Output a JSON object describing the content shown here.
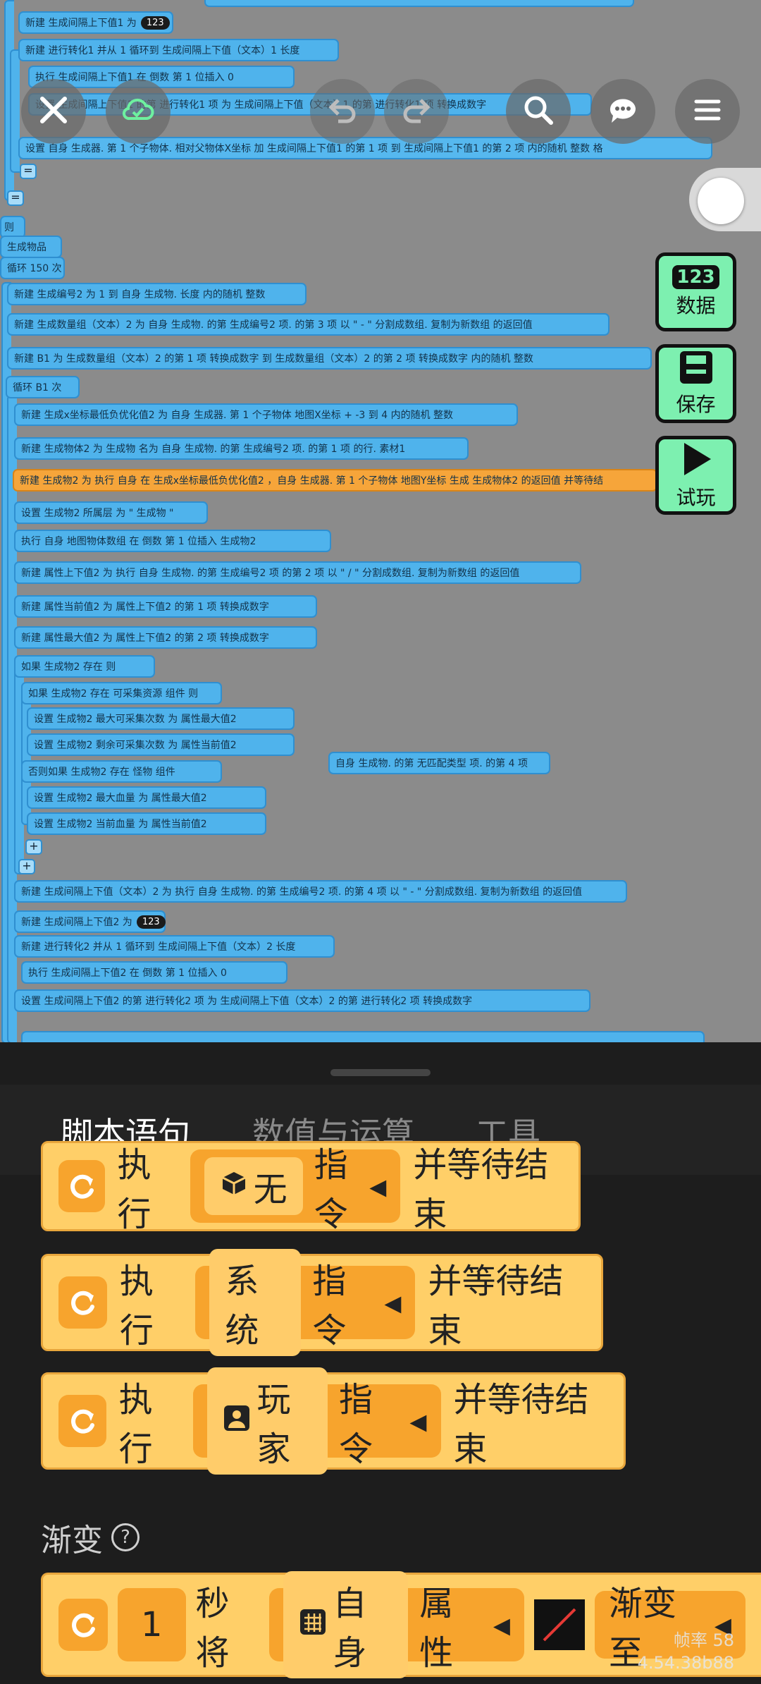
{
  "editor": {
    "lines": [
      {
        "id": "l01",
        "text": "新建  生成间隔上下值1  为",
        "badge": "123"
      },
      {
        "id": "l02",
        "text": "新建  进行转化1  并从  1  循环到  生成间隔上下值（文本）1  长度"
      },
      {
        "id": "l03",
        "text": "执行  生成间隔上下值1  在  倒数  第  1  位插入  0"
      },
      {
        "id": "l04",
        "text": "设置  生成间隔上下值1  的第  进行转化1  项  为  生成间隔上下值（文本）1  的第  进行转化1  项  转换成数字"
      },
      {
        "id": "l05",
        "text": "设置  自身  生成器. 第  1  个子物体. 相对父物体X坐标  加  生成间隔上下值1  的第  1  项  到  生成间隔上下值1  的第  2  项  内的随机  整数  格"
      },
      {
        "id": "l06",
        "text": "则"
      },
      {
        "id": "l07",
        "text": "生成物品"
      },
      {
        "id": "l08",
        "text": "循环  150  次"
      },
      {
        "id": "l09",
        "text": "新建  生成编号2  为  1  到  自身  生成物. 长度  内的随机  整数"
      },
      {
        "id": "l10",
        "text": "新建  生成数量组（文本）2  为  自身  生成物. 的第  生成编号2  项. 的第  3  项  以 \" - \" 分割成数组. 复制为新数组  的返回值"
      },
      {
        "id": "l11",
        "text": "新建  B1  为  生成数量组（文本）2  的第  1  项  转换成数字  到  生成数量组（文本）2  的第  2  项  转换成数字  内的随机  整数"
      },
      {
        "id": "l12",
        "text": "循环  B1  次"
      },
      {
        "id": "l13",
        "text": "新建  生成x坐标最低负优化值2  为  自身  生成器. 第  1  个子物体  地图X坐标  +  -3  到  4  内的随机  整数"
      },
      {
        "id": "l14",
        "text": "新建  生成物体2  为  生成物  名为  自身  生成物. 的第  生成编号2  项. 的第  1  项  的行. 素材1"
      },
      {
        "id": "l15",
        "text": "新建  生成物2  为  执行  自身  在  生成x坐标最低负优化值2 ，自身 生成器. 第 1 个子物体  地图Y坐标  生成  生成物体2  的返回值  并等待结"
      },
      {
        "id": "l16",
        "text": "设置  生成物2  所属层  为  \" 生成物 \""
      },
      {
        "id": "l17",
        "text": "执行  自身  地图物体数组  在  倒数  第  1  位插入  生成物2"
      },
      {
        "id": "l18",
        "text": "新建  属性上下值2  为  执行  自身  生成物. 的第  生成编号2  项  的第  2  项  以 \" / \" 分割成数组. 复制为新数组  的返回值"
      },
      {
        "id": "l19",
        "text": "新建  属性当前值2  为  属性上下值2  的第  1  项  转换成数字"
      },
      {
        "id": "l20",
        "text": "新建  属性最大值2  为  属性上下值2  的第  2  项  转换成数字"
      },
      {
        "id": "l21",
        "text": "如果  生成物2  存在  则"
      },
      {
        "id": "l22",
        "text": "如果  生成物2  存在  可采集资源  组件  则"
      },
      {
        "id": "l23",
        "text": "设置  生成物2  最大可采集次数  为  属性最大值2"
      },
      {
        "id": "l24",
        "text": "设置  生成物2  剩余可采集次数  为  属性当前值2"
      },
      {
        "id": "l25",
        "text": "否则如果  生成物2  存在  怪物  组件"
      },
      {
        "id": "l26",
        "text": "设置  生成物2  最大血量  为  属性最大值2"
      },
      {
        "id": "l27",
        "text": "设置  生成物2  当前血量  为  属性当前值2"
      },
      {
        "id": "l28",
        "text": "自身  生成物. 的第  无匹配类型  项. 的第  4  项"
      },
      {
        "id": "l29",
        "text": "新建  生成间隔上下值（文本）2  为  执行  自身  生成物. 的第  生成编号2  项. 的第  4  项  以 \" - \" 分割成数组. 复制为新数组  的返回值"
      },
      {
        "id": "l30",
        "text": "新建  生成间隔上下值2  为",
        "badge": "123"
      },
      {
        "id": "l31",
        "text": "新建  进行转化2  并从  1  循环到  生成间隔上下值（文本）2  长度"
      },
      {
        "id": "l32",
        "text": "执行  生成间隔上下值2  在  倒数  第  1  位插入  0"
      },
      {
        "id": "l33",
        "text": "设置  生成间隔上下值2  的第  进行转化2  项  为  生成间隔上下值（文本）2  的第  进行转化2  项  转换成数字"
      }
    ]
  },
  "toolbar": {
    "close": "close-icon",
    "cloud": "cloud-save-icon",
    "undo": "undo-icon",
    "redo": "redo-icon",
    "search": "search-icon",
    "chat": "chat-icon",
    "menu": "menu-icon"
  },
  "side_buttons": {
    "data": {
      "label": "数据",
      "badge": "123"
    },
    "save": {
      "label": "保存"
    },
    "play": {
      "label": "试玩"
    }
  },
  "palette": {
    "tabs": [
      "脚本语句",
      "数值与运算",
      "工具"
    ],
    "active_tab": 0,
    "blocks": [
      {
        "prefix": "执行",
        "target_icon": "cube-icon",
        "target": "无",
        "cmd": "指令",
        "suffix": "并等待结束"
      },
      {
        "prefix": "执行",
        "target": "系统",
        "cmd": "指令",
        "suffix": "并等待结束"
      },
      {
        "prefix": "执行",
        "target_icon": "person-icon",
        "target": "玩家",
        "cmd": "指令",
        "suffix": "并等待结束"
      }
    ],
    "section_title": "渐变",
    "tween_block": {
      "value": "1",
      "text1": "秒将",
      "target": "自身",
      "prop": "属性",
      "action": "渐变至"
    },
    "fps_label": "帧率 58",
    "version": "4.54.38b88"
  },
  "colors": {
    "accent": "#1aa7ff",
    "block_blue": "#4fb3ec",
    "block_orange": "#ffcf68",
    "side_green": "#7df0b0"
  }
}
